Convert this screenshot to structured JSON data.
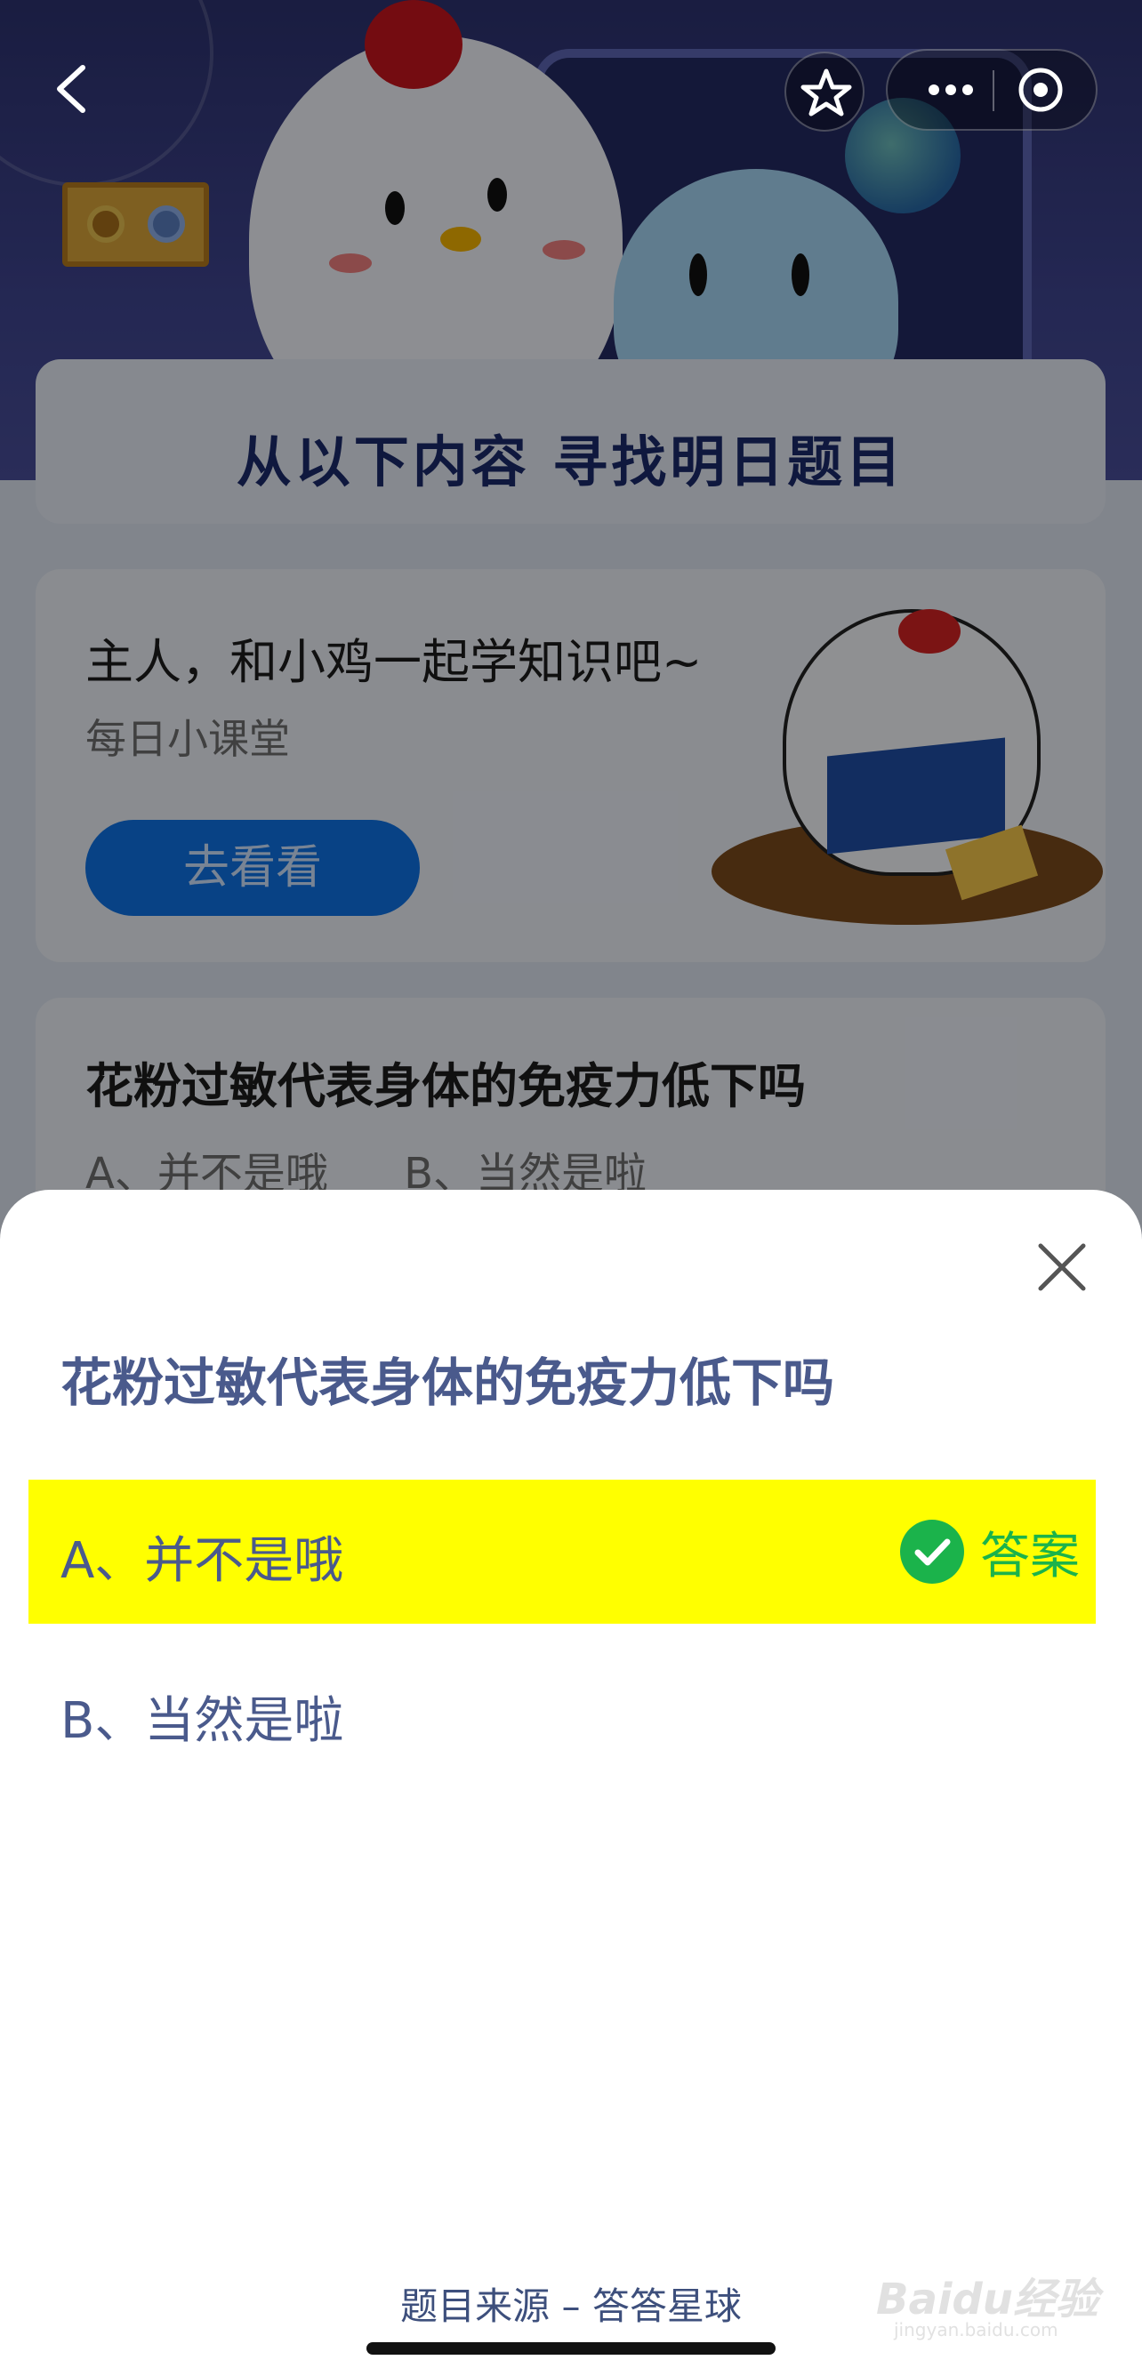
{
  "background": {
    "title_banner": "从以下内容  寻找明日题目",
    "card1": {
      "title": "主人，和小鸡一起学知识吧~",
      "subtitle": "每日小课堂",
      "button": "去看看"
    },
    "card2": {
      "question": "花粉过敏代表身体的免疫力低下吗",
      "options": [
        "A、并不是哦",
        "B、当然是啦"
      ]
    }
  },
  "sheet": {
    "question": "花粉过敏代表身体的免疫力低下吗",
    "options": [
      {
        "label": "A、并不是哦",
        "is_answer": true,
        "badge": "答案"
      },
      {
        "label": "B、当然是啦",
        "is_answer": false
      }
    ],
    "source": "题目来源 – 答答星球"
  },
  "watermark": {
    "brand": "Baidu经验",
    "url": "jingyan.baidu.com"
  },
  "colors": {
    "highlight": "#ffff00",
    "answer_green": "#1bb34b",
    "question_text": "#4a5a8c",
    "button_blue": "#0f73e6"
  }
}
